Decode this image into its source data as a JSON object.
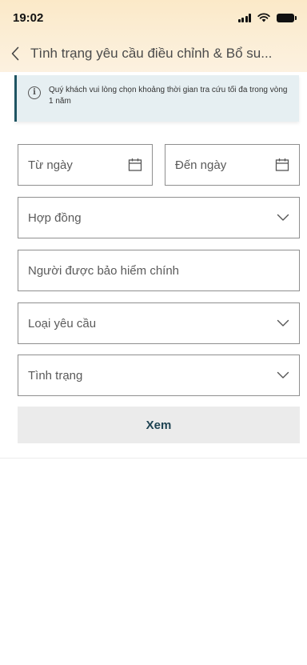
{
  "status_bar": {
    "time": "19:02"
  },
  "header": {
    "title": "Tình trạng yêu cầu điều chỉnh & Bổ su..."
  },
  "notice": {
    "text": "Quý khách vui lòng chọn khoảng thời gian tra cứu tối đa trong vòng 1 năm"
  },
  "filters": {
    "from_date": "Từ ngày",
    "to_date": "Đến ngày",
    "contract": "Hợp đồng",
    "insured": "Người được bảo hiểm chính",
    "request_type": "Loại yêu cầu",
    "status": "Tình trạng"
  },
  "actions": {
    "view_label": "Xem"
  }
}
